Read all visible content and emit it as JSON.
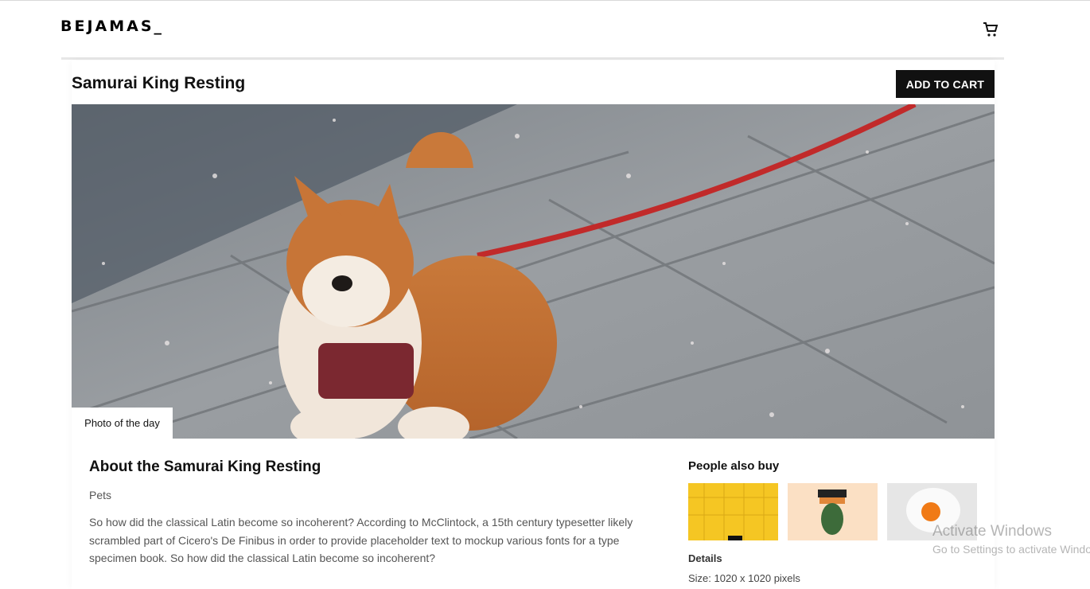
{
  "header": {
    "logo": "BEJAMAS_",
    "cart_icon": "cart-icon"
  },
  "product": {
    "title": "Samurai King Resting",
    "add_to_cart_label": "ADD TO CART",
    "badge": "Photo of the day",
    "about_heading": "About the Samurai King Resting",
    "category": "Pets",
    "description": "So how did the classical Latin become so incoherent? According to McClintock, a 15th century typesetter likely scrambled part of Cicero's De Finibus in order to provide placeholder text to mockup various fonts for a type specimen book. So how did the classical Latin become so incoherent?"
  },
  "sidebar": {
    "people_also_buy": "People also buy",
    "details_heading": "Details",
    "size": "Size: 1020 x 1020 pixels"
  },
  "watermark": {
    "line1": "Activate Windows",
    "line2": "Go to Settings to activate Windows."
  },
  "colors": {
    "button_bg": "#111111",
    "thumb1_bg": "#f5c623",
    "thumb2_bg": "#fbe0c4",
    "thumb3_bg": "#e6e6e6"
  }
}
